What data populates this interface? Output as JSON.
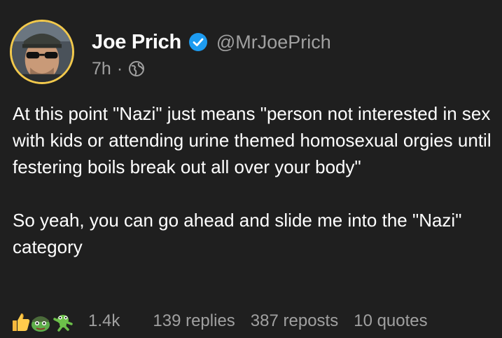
{
  "author": {
    "display_name": "Joe Prich",
    "handle": "@MrJoePrich",
    "verified": true,
    "avatar_ring_color": "#f2c94c"
  },
  "meta": {
    "timestamp": "7h",
    "separator": "·",
    "visibility_icon": "globe-icon"
  },
  "post": {
    "paragraphs": [
      "At this point \"Nazi\" just means \"person not interested in sex with kids or attending urine themed homosexual orgies until festering boils break out all over your body\"",
      "So yeah, you can go ahead and slide me into the \"Nazi\" category"
    ]
  },
  "stats": {
    "reaction_icons": [
      "thumbs-up-icon",
      "frog-soldier-icon",
      "frog-dancing-icon"
    ],
    "likes": "1.4k",
    "replies": "139 replies",
    "reposts": "387 reposts",
    "quotes": "10 quotes"
  },
  "colors": {
    "background": "#1f1f1f",
    "text_primary": "#ffffff",
    "text_secondary": "#a0a0a0",
    "verified_badge": "#1d9bf0"
  }
}
